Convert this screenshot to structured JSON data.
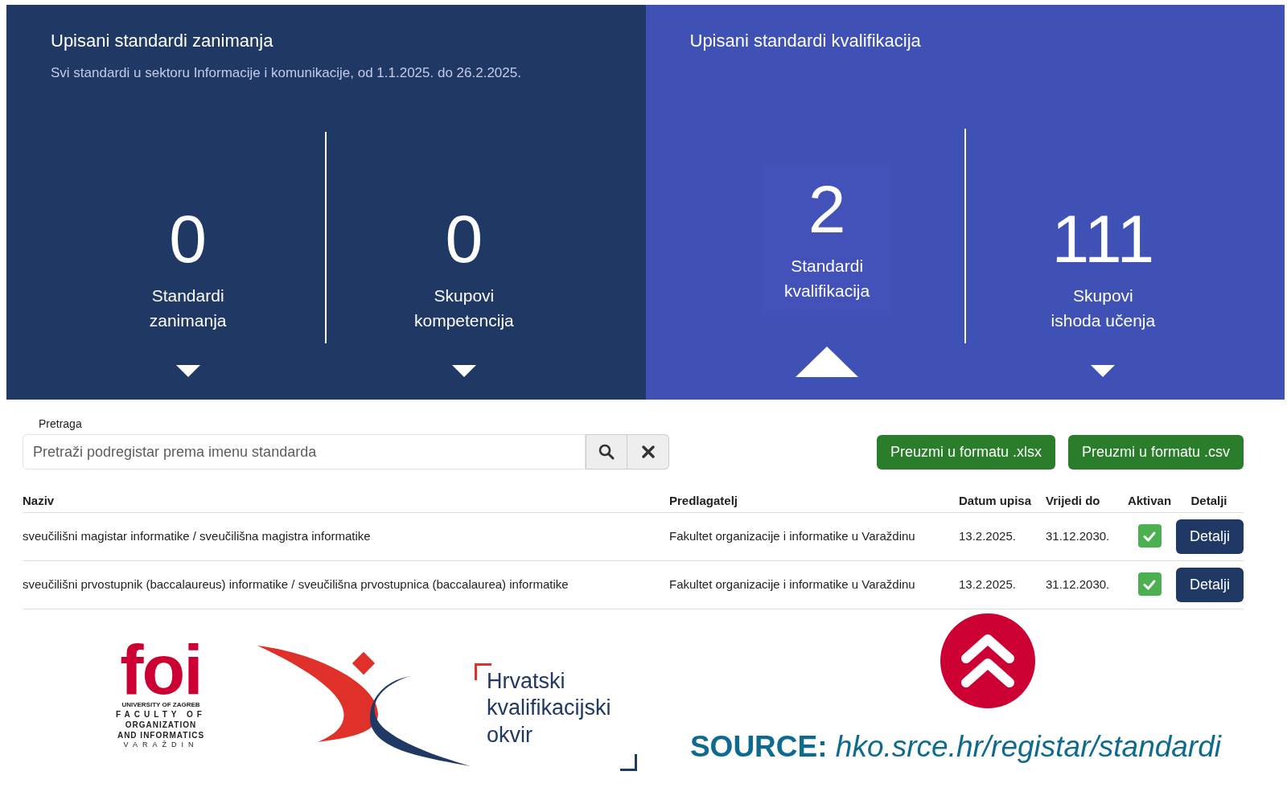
{
  "panels": [
    {
      "title": "Upisani standardi zanimanja",
      "subtitle": "Svi standardi u sektoru Informacije i komunikacije, od 1.1.2025. do 26.2.2025.",
      "color": "#1f3864",
      "stats": [
        {
          "value": "0",
          "label": "Standardi zanimanja",
          "selected": false
        },
        {
          "value": "0",
          "label": "Skupovi kompetencija",
          "selected": false
        }
      ]
    },
    {
      "title": "Upisani standardi kvalifikacija",
      "color": "#3f51b5",
      "stats": [
        {
          "value": "2",
          "label": "Standardi kvalifikacija",
          "selected": true
        },
        {
          "value": "111",
          "label": "Skupovi ishoda učenja",
          "selected": false
        }
      ]
    }
  ],
  "search": {
    "label": "Pretraga",
    "placeholder": "Pretraži podregistar prema imenu standarda"
  },
  "downloads": [
    "Preuzmi u formatu .xlsx",
    "Preuzmi u formatu .csv"
  ],
  "table": {
    "columns": [
      "Naziv",
      "Predlagatelj",
      "Datum upisa",
      "Vrijedi do",
      "Aktivan",
      "Detalji"
    ],
    "rows": [
      {
        "naziv": "sveučilišni magistar informatike / sveučilišna magistra informatike",
        "predlagatelj": "Fakultet organizacije i informatike u Varaždinu",
        "datum_upisa": "13.2.2025.",
        "vrijedi_do": "31.12.2030.",
        "active": true,
        "action": "Detalji"
      },
      {
        "naziv": "sveučilišni prvostupnik (baccalaureus) informatike / sveučilišna prvostupnica (baccalaurea) informatike",
        "predlagatelj": "Fakultet organizacije i informatike u Varaždinu",
        "datum_upisa": "13.2.2025.",
        "vrijedi_do": "31.12.2030.",
        "active": true,
        "action": "Detalji"
      }
    ]
  },
  "logos": {
    "foi": {
      "letters": "foi",
      "lines": [
        "UNIVERSITY OF ZAGREB",
        "FACULTY OF",
        "ORGANIZATION",
        "AND INFORMATICS",
        "VARAŽDIN"
      ]
    },
    "hko": {
      "lines": [
        "Hrvatski",
        "kvalifikacijski",
        "okvir"
      ]
    }
  },
  "source": "**SOURCE:** *hko.srce.hr/registar/standardi*"
}
